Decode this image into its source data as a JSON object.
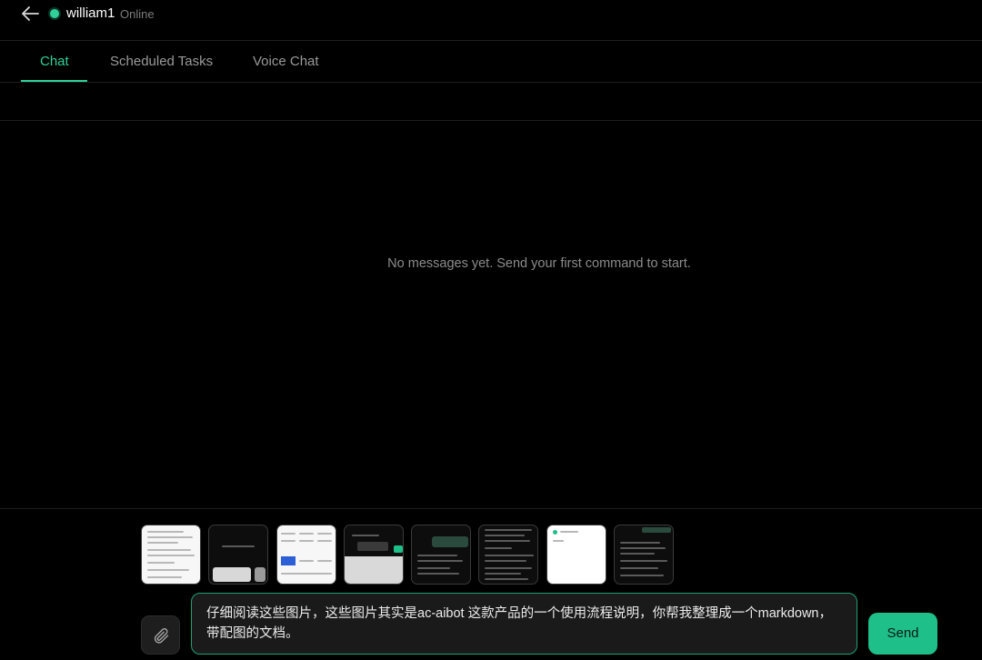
{
  "header": {
    "username": "william1",
    "status": "Online",
    "status_color": "#2fd09a",
    "back_icon": "arrow-left-icon"
  },
  "tabs": [
    {
      "label": "Chat",
      "active": true
    },
    {
      "label": "Scheduled Tasks",
      "active": false
    },
    {
      "label": "Voice Chat",
      "active": false
    }
  ],
  "messages": {
    "empty_text": "No messages yet. Send your first command to start."
  },
  "composer": {
    "attachments_count": 8,
    "attach_icon": "paperclip-icon",
    "input_value": "仔细阅读这些图片，这些图片其实是ac-aibot 这款产品的一个使用流程说明，你帮我整理成一个markdown，带配图的文档。",
    "send_label": "Send",
    "accent": "#1fbf8a"
  }
}
